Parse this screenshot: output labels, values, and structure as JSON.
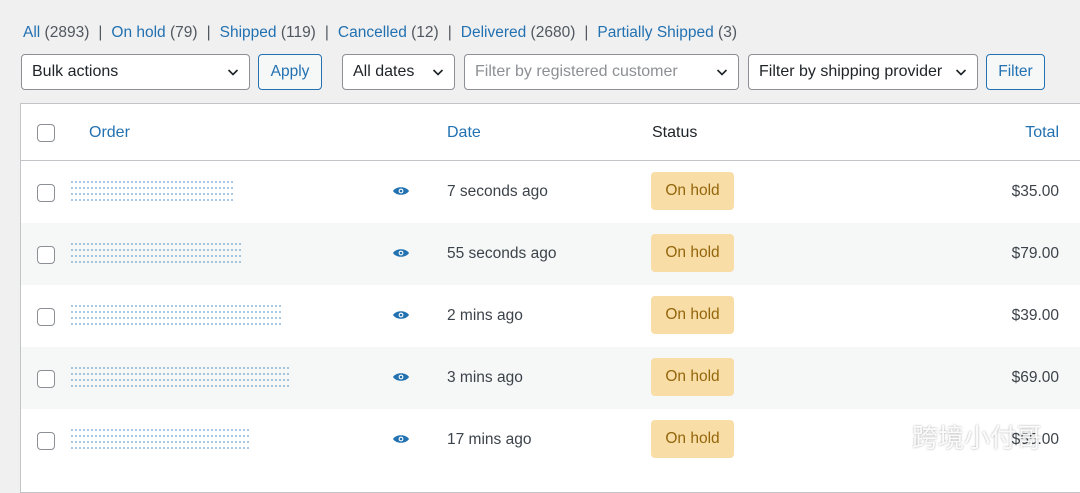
{
  "status_filters": [
    {
      "label": "All",
      "count": "(2893)"
    },
    {
      "label": "On hold",
      "count": "(79)"
    },
    {
      "label": "Shipped",
      "count": "(119)"
    },
    {
      "label": "Cancelled",
      "count": "(12)"
    },
    {
      "label": "Delivered",
      "count": "(2680)"
    },
    {
      "label": "Partially Shipped",
      "count": "(3)"
    }
  ],
  "separator": "|",
  "toolbar": {
    "bulk_actions": "Bulk actions",
    "apply_label": "Apply",
    "dates": "All dates",
    "customer_placeholder": "Filter by registered customer",
    "shipping_provider": "Filter by shipping provider",
    "filter_label": "Filter"
  },
  "table": {
    "headers": {
      "order": "Order",
      "date": "Date",
      "status": "Status",
      "total": "Total"
    },
    "rows": [
      {
        "date": "7 seconds ago",
        "status": "On hold",
        "total": "$35.00"
      },
      {
        "date": "55 seconds ago",
        "status": "On hold",
        "total": "$79.00"
      },
      {
        "date": "2 mins ago",
        "status": "On hold",
        "total": "$39.00"
      },
      {
        "date": "3 mins ago",
        "status": "On hold",
        "total": "$69.00"
      },
      {
        "date": "17 mins ago",
        "status": "On hold",
        "total": "$55.00"
      }
    ]
  },
  "colors": {
    "link": "#2271b1",
    "on_hold_bg": "#f8dda7",
    "on_hold_text": "#94660c"
  },
  "icons": {
    "preview": "eye-icon",
    "dropdown": "chevron-down-icon",
    "watermark": "wechat-logo-icon"
  },
  "watermark": "跨境小付哥"
}
